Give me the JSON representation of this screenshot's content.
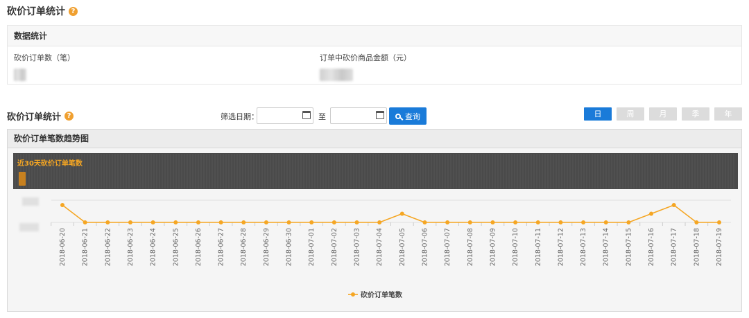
{
  "page_title": "砍价订单统计",
  "help_icon_glyph": "?",
  "stats": {
    "header": "数据统计",
    "order_count_label": "砍价订单数（笔）",
    "amount_label": "订单中砍价商品金额（元）"
  },
  "section_title": "砍价订单统计",
  "filter": {
    "label": "筛选日期：",
    "start_value": "",
    "end_value": "",
    "to_label": "至",
    "query_label": "查询"
  },
  "period_tabs": [
    {
      "label": "日",
      "active": true
    },
    {
      "label": "周",
      "active": false
    },
    {
      "label": "月",
      "active": false
    },
    {
      "label": "季",
      "active": false
    },
    {
      "label": "年",
      "active": false
    }
  ],
  "chart_panel_title": "砍价订单笔数趋势图",
  "colors": {
    "accent": "#1a7bd9",
    "series": "#f5a623",
    "dark_band": "#4a4a4a"
  },
  "chart_data": {
    "type": "line",
    "title": "近30天砍价订单笔数",
    "x": [
      "2018-06-20",
      "2018-06-21",
      "2018-06-22",
      "2018-06-23",
      "2018-06-24",
      "2018-06-25",
      "2018-06-26",
      "2018-06-27",
      "2018-06-28",
      "2018-06-29",
      "2018-06-30",
      "2018-07-01",
      "2018-07-02",
      "2018-07-03",
      "2018-07-04",
      "2018-07-05",
      "2018-07-06",
      "2018-07-07",
      "2018-07-08",
      "2018-07-09",
      "2018-07-10",
      "2018-07-11",
      "2018-07-12",
      "2018-07-13",
      "2018-07-14",
      "2018-07-15",
      "2018-07-16",
      "2018-07-17",
      "2018-07-18",
      "2018-07-19"
    ],
    "series": [
      {
        "name": "砍价订单笔数",
        "values": [
          2,
          0,
          0,
          0,
          0,
          0,
          0,
          0,
          0,
          0,
          0,
          0,
          0,
          0,
          0,
          1,
          0,
          0,
          0,
          0,
          0,
          0,
          0,
          0,
          0,
          0,
          1,
          2,
          0,
          0
        ]
      }
    ],
    "ylim": [
      0,
      2
    ],
    "grid": true,
    "legend": "bottom-center"
  }
}
